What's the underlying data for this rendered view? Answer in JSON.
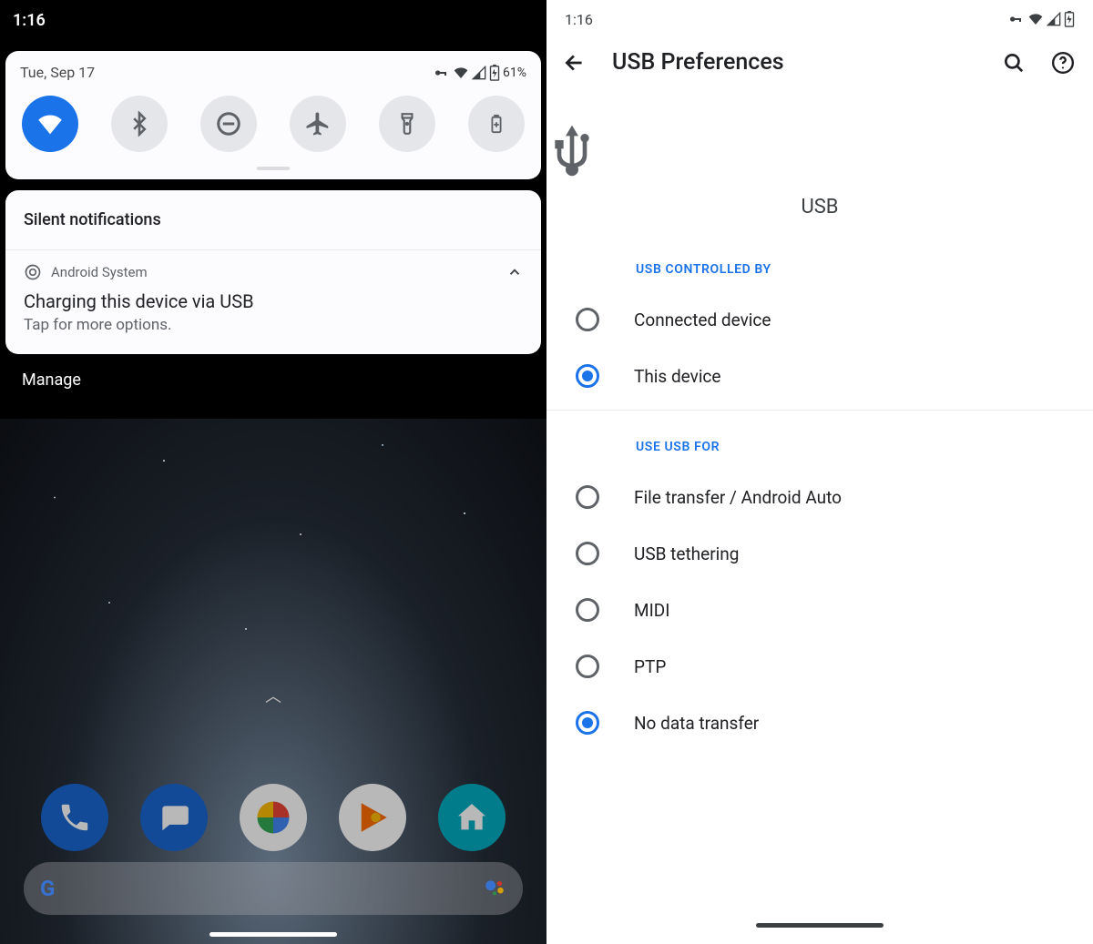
{
  "left": {
    "clock": "1:16",
    "qs": {
      "date": "Tue, Sep 17",
      "battery_pct": "61%",
      "tiles": [
        {
          "name": "wifi",
          "active": true
        },
        {
          "name": "bluetooth",
          "active": false
        },
        {
          "name": "dnd",
          "active": false
        },
        {
          "name": "airplane",
          "active": false
        },
        {
          "name": "flashlight",
          "active": false
        },
        {
          "name": "battery-saver",
          "active": false
        }
      ]
    },
    "silent_header": "Silent notifications",
    "notif": {
      "app": "Android System",
      "title": "Charging this device via USB",
      "subtitle": "Tap for more options."
    },
    "manage": "Manage"
  },
  "right": {
    "clock": "1:16",
    "title": "USB Preferences",
    "usb_label": "USB",
    "sections": [
      {
        "header": "USB CONTROLLED BY",
        "options": [
          {
            "label": "Connected device",
            "selected": false
          },
          {
            "label": "This device",
            "selected": true
          }
        ]
      },
      {
        "header": "USE USB FOR",
        "options": [
          {
            "label": "File transfer / Android Auto",
            "selected": false
          },
          {
            "label": "USB tethering",
            "selected": false
          },
          {
            "label": "MIDI",
            "selected": false
          },
          {
            "label": "PTP",
            "selected": false
          },
          {
            "label": "No data transfer",
            "selected": true
          }
        ]
      }
    ]
  }
}
